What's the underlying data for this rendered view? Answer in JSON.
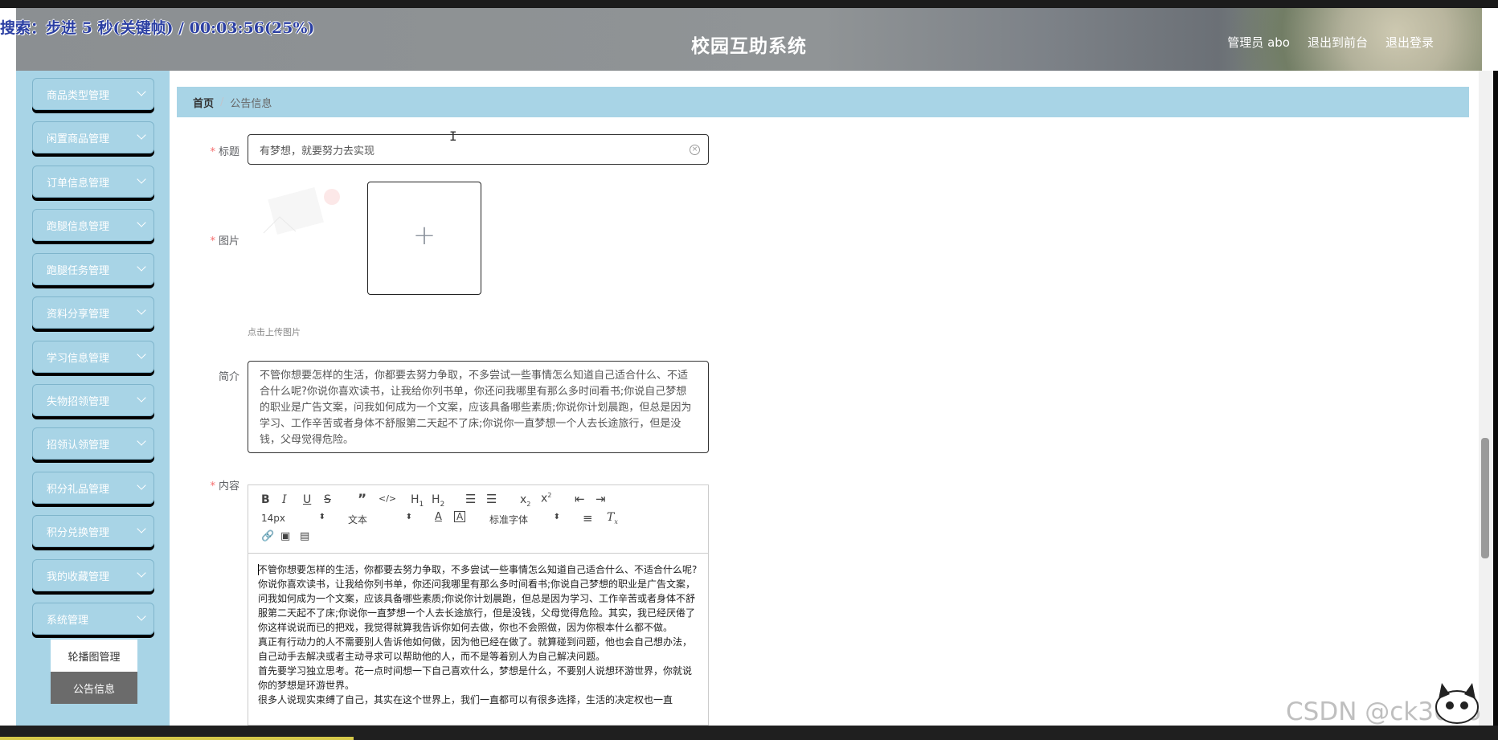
{
  "header": {
    "title": "校园互助系统",
    "admin_label": "管理员 abo",
    "back_to_front": "退出到前台",
    "logout": "退出登录"
  },
  "overlay": {
    "text": "搜索：步进 5 秒(关键帧) / 00:03:56(25%)"
  },
  "sidebar": {
    "items": [
      {
        "label": "商品类型管理"
      },
      {
        "label": "闲置商品管理"
      },
      {
        "label": "订单信息管理"
      },
      {
        "label": "跑腿信息管理"
      },
      {
        "label": "跑腿任务管理"
      },
      {
        "label": "资料分享管理"
      },
      {
        "label": "学习信息管理"
      },
      {
        "label": "失物招领管理"
      },
      {
        "label": "招领认领管理"
      },
      {
        "label": "积分礼品管理"
      },
      {
        "label": "积分兑换管理"
      },
      {
        "label": "我的收藏管理"
      },
      {
        "label": "系统管理"
      }
    ],
    "sub_items": [
      {
        "label": "轮播图管理"
      },
      {
        "label": "公告信息"
      }
    ]
  },
  "breadcrumb": {
    "home": "首页",
    "separator": "/",
    "current": "公告信息"
  },
  "form": {
    "title_label": "标题",
    "title_value": "有梦想，就要努力去实现",
    "image_label": "图片",
    "upload_hint": "点击上传图片",
    "summary_label": "简介",
    "summary_value": "不管你想要怎样的生活，你都要去努力争取，不多尝试一些事情怎么知道自己适合什么、不适合什么呢?你说你喜欢读书，让我给你列书单，你还问我哪里有那么多时间看书;你说自己梦想的职业是广告文案，问我如何成为一个文案，应该具备哪些素质;你说你计划晨跑，但总是因为学习、工作辛苦或者身体不舒服第二天起不了床;你说你一直梦想一个人去长途旅行，但是没钱，父母觉得危险。",
    "content_label": "内容",
    "required_mark": "*"
  },
  "editor": {
    "font_size": "14px",
    "block_type": "文本",
    "font_family": "标准字体",
    "content_lines": [
      "不管你想要怎样的生活，你都要去努力争取，不多尝试一些事情怎么知道自己适合什么、不适合什么呢?",
      "你说你喜欢读书，让我给你列书单，你还问我哪里有那么多时间看书;你说自己梦想的职业是广告文案，问我如何成为一个文案，应该具备哪些素质;你说你计划晨跑，但总是因为学习、工作辛苦或者身体不舒服第二天起不了床;你说你一直梦想一个人去长途旅行，但是没钱，父母觉得危险。其实，我已经厌倦了你这样说说而已的把戏，我觉得就算我告诉你如何去做，你也不会照做，因为你根本什么都不做。",
      "真正有行动力的人不需要别人告诉他如何做，因为他已经在做了。就算碰到问题，他也会自己想办法，自己动手去解决或者主动寻求可以帮助他的人，而不是等着别人为自己解决问题。",
      "首先要学习独立思考。花一点时间想一下自己喜欢什么，梦想是什么，不要别人说想环游世界，你就说你的梦想是环游世界。",
      "很多人说现实束缚了自己，其实在这个世界上，我们一直都可以有很多选择，生活的决定权也一直"
    ]
  },
  "watermark": "CSDN @ck3016",
  "colors": {
    "sidebar_bg": "#a8d4e6",
    "breadcrumb_bg": "#a8d4e6",
    "required": "#f56c6c",
    "active_sub": "#6b6b6b"
  }
}
